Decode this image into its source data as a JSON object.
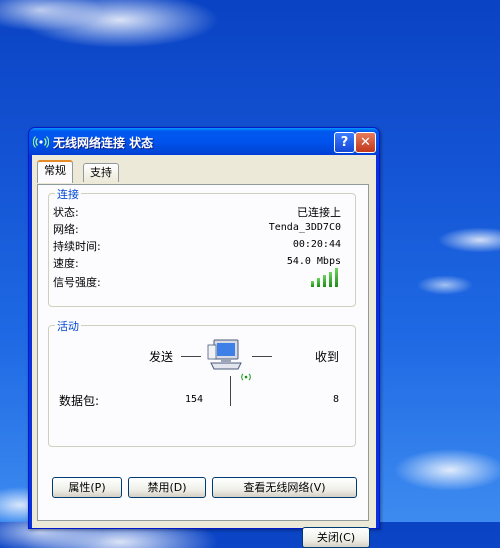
{
  "window": {
    "title": "无线网络连接 状态",
    "help_label": "?",
    "close_label": "✕"
  },
  "tabs": [
    {
      "label": "常规",
      "active": true
    },
    {
      "label": "支持",
      "active": false
    }
  ],
  "connection": {
    "group_title": "连接",
    "rows": [
      {
        "label": "状态:",
        "value": "已连接上"
      },
      {
        "label": "网络:",
        "value": "Tenda_3DD7C0"
      },
      {
        "label": "持续时间:",
        "value": "00:20:44"
      },
      {
        "label": "速度:",
        "value": "54.0 Mbps"
      }
    ],
    "signal_label": "信号强度:",
    "signal_strength_bars": 5,
    "signal_strength_max": 5
  },
  "activity": {
    "group_title": "活动",
    "sent_label": "发送",
    "received_label": "收到",
    "packets_label": "数据包:",
    "packets_sent": "154",
    "packets_received": "8"
  },
  "buttons": {
    "properties": "属性(P)",
    "disable": "禁用(D)",
    "view_networks": "查看无线网络(V)",
    "close": "关闭(C)"
  },
  "colors": {
    "titlebar": "#0058ee",
    "group_title": "#0046d5",
    "signal": "#3cb832"
  }
}
